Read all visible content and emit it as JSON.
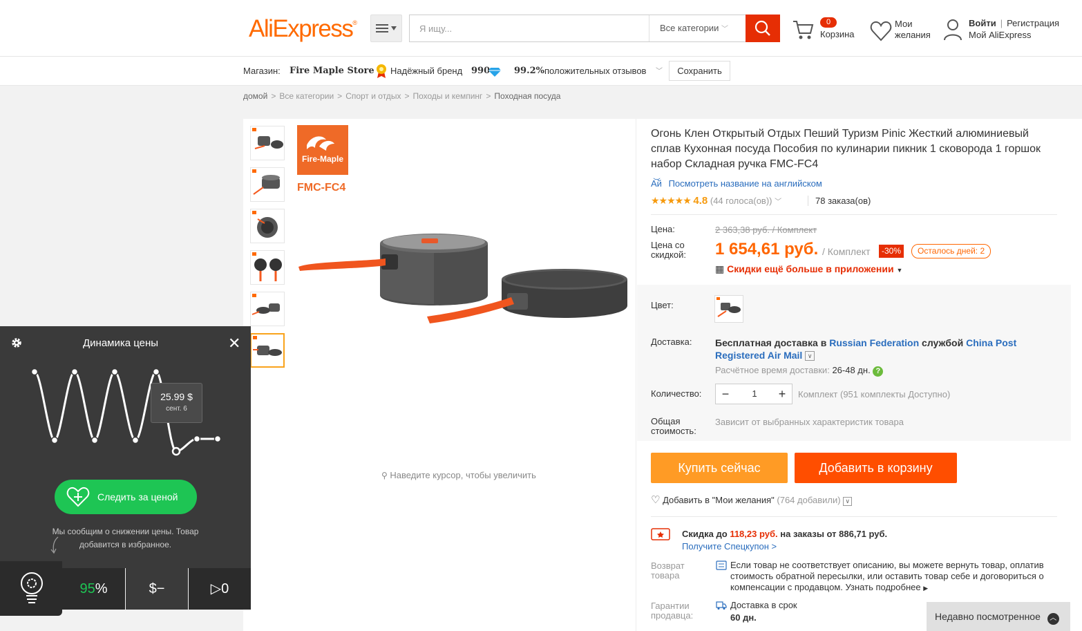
{
  "header": {
    "logo": "AliExpress",
    "search_placeholder": "Я ищу...",
    "category_select": "Все категории",
    "cart_count": "0",
    "cart_label": "Корзина",
    "wishlist_label": "Мои желания",
    "login": "Войти",
    "register": "Регистрация",
    "my_account": "Мой AliExpress"
  },
  "store": {
    "label": "Магазин:",
    "name": "Fire Maple Store",
    "brand_label": "Надёжный бренд",
    "score": "990",
    "positive_pct": "99.2%",
    "positive_label": "положительных отзывов",
    "save_label": "Сохранить"
  },
  "breadcrumbs": [
    "домой",
    "Все категории",
    "Спорт и отдых",
    "Походы и кемпинг",
    "Походная посуда"
  ],
  "gallery": {
    "brand_logo_text": "Fire-Maple",
    "model": "FMC-FC4",
    "zoom_hint": "Наведите курсор, чтобы увеличить"
  },
  "product": {
    "title": "Огонь Клен Открытый Отдых Пеший Туризм Pinic Жесткий алюминиевый сплав Кухонная посуда Пособия по кулинарии пикник 1 сковорода 1 горшок набор Складная ручка FMC-FC4",
    "english_link": "Посмотреть название на английском",
    "rating": "4.8",
    "votes": "(44 голоса(ов))",
    "orders": "78 заказа(ов)",
    "price_label": "Цена:",
    "old_price": "2 363,38 руб. / Комплект",
    "discount_price_label": "Цена со скидкой:",
    "new_price": "1 654,61 руб.",
    "unit": "/ Комплект",
    "discount": "-30%",
    "days_left": "Осталось дней: 2",
    "app_discount": "Скидки ещё больше в приложении",
    "color_label": "Цвет:",
    "delivery_label": "Доставка:",
    "delivery_text_1": "Бесплатная доставка в",
    "delivery_country": "Russian Federation",
    "delivery_text_2": "службой",
    "delivery_service": "China Post Registered Air Mail",
    "delivery_time_label": "Расчётное время доставки:",
    "delivery_time": "26-48 дн.",
    "quantity_label": "Количество:",
    "quantity": "1",
    "availability": "Комплект (951 комплекты Доступно)",
    "total_label": "Общая стоимость:",
    "total_text": "Зависит от выбранных характеристик товара",
    "buy_now": "Купить сейчас",
    "add_to_cart": "Добавить в корзину",
    "add_wish": "Добавить в \"Мои желания\"",
    "wish_count": "(764 добавили)",
    "coupon_text_1": "Скидка до",
    "coupon_amount": "118,23 руб.",
    "coupon_text_2": "на заказы от 886,71 руб.",
    "coupon_link": "Получите Спецкупон >",
    "return_label": "Возврат товара",
    "return_text": "Если товар не соответствует описанию, вы можете вернуть товар, оплатив стоимость обратной пересылки, или оставить товар себе и договориться о компенсации с продавцом.",
    "return_more": "Узнать подробнее",
    "guarantee_label": "Гарантии продавца:",
    "guarantee_text": "Доставка в срок",
    "guarantee_days": "60 дн.",
    "recently_viewed": "Недавно посмотренное"
  },
  "price_widget": {
    "title": "Динамика цены",
    "tooltip_value": "25.99 $",
    "tooltip_date": "сент. 6",
    "track_button": "Следить за ценой",
    "note": "Мы сообщим о снижении цены. Товар добавится в избранное.",
    "score": "95",
    "score_unit": "%",
    "dollar": "$−",
    "play": "▷0"
  },
  "colors": {
    "brand_orange": "#ff6a00",
    "search_red": "#e62e04",
    "buy_now": "#ff9b25",
    "add_cart": "#ff4e00",
    "track_green": "#1ec554"
  }
}
